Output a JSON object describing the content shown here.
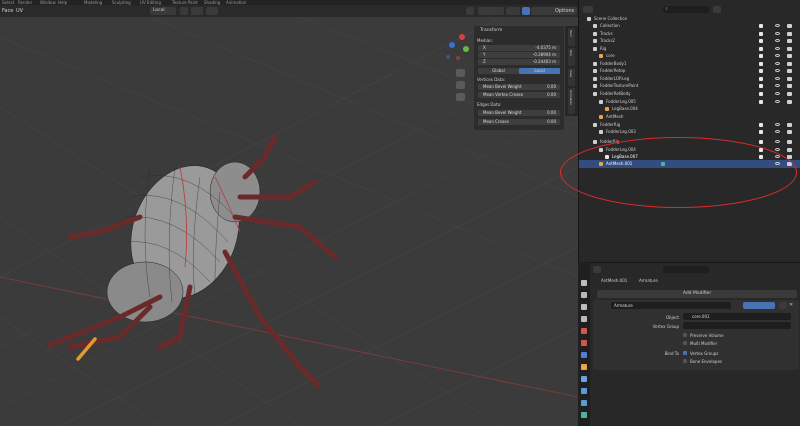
{
  "top_menu": {
    "items": [
      "Select",
      "Render",
      "Window",
      "Help",
      "Modeling",
      "Sculpting",
      "UV Editing",
      "Texture Paint",
      "Shading",
      "Animation",
      "Rendering",
      "Compositing"
    ]
  },
  "header": {
    "mode_left": "Face",
    "uv_label": "UV",
    "orientation": "Local",
    "options_label": "Options"
  },
  "npanel": {
    "section": "Transform",
    "median_label": "Median:",
    "x_label": "X",
    "x_value": "-4.0375 m",
    "y_label": "Y",
    "y_value": "-0.28904 m",
    "z_label": "Z",
    "z_value": "-0.24403 m",
    "global_label": "Global",
    "local_label": "Local",
    "vertices_data": "Vertices Data:",
    "mean_bevel_weight": "Mean Bevel Weight",
    "mbw_value": "0.00",
    "mean_vertex_crease": "Mean Vertex Crease",
    "mvc_value": "0.00",
    "edges_data": "Edges Data:",
    "edge_bevel_weight": "Mean Bevel Weight",
    "ebw_value": "0.00",
    "edge_crease": "Mean Crease",
    "ec_value": "0.00",
    "tabs": [
      "Item",
      "Tool",
      "View",
      "Animation"
    ]
  },
  "outliner": {
    "search_placeholder": "",
    "root": "Scene Collection",
    "rows": [
      "Collection",
      "Tracks",
      "Tracks2",
      "Rig",
      "core",
      "FodderBody1",
      "FodderRetop",
      "FodderLOP.Leg",
      "FodderTexturePaint",
      "FodderRetBody",
      "FodderLeg.005",
      "LegBase.004",
      "AntMesh",
      "FodderRig",
      "FodderLeg.003",
      "AntMesh.001",
      "fodderRig",
      "FodderLeg.004",
      "LegBase.007",
      "AntMesh.001"
    ]
  },
  "properties": {
    "object_name": "AntMesh.001",
    "modifier_context": "Armature",
    "add_modifier": "Add Modifier",
    "modifier_name": "Armature",
    "object_label": "Object",
    "object_value": "core.001",
    "vertex_group_label": "Vertex Group",
    "preserve_volume": "Preserve Volume",
    "multi_modifier": "Multi Modifier",
    "bind_to_label": "Bind To",
    "vertex_groups": "Vertex Groups",
    "bone_envelopes": "Bone Envelopes"
  },
  "colors": {
    "annotation": "#e22a2a",
    "selection": "#334d80",
    "accent": "#4772b3"
  }
}
